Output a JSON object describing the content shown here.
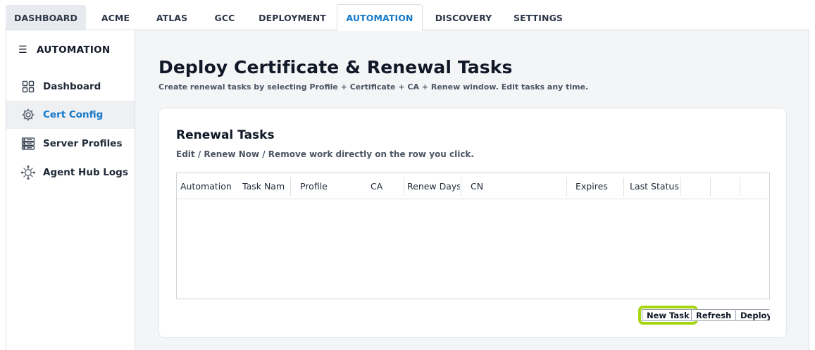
{
  "tabs": [
    {
      "label": "DASHBOARD"
    },
    {
      "label": "ACME"
    },
    {
      "label": "ATLAS"
    },
    {
      "label": "GCC"
    },
    {
      "label": "DEPLOYMENT"
    },
    {
      "label": "AUTOMATION"
    },
    {
      "label": "DISCOVERY"
    },
    {
      "label": "SETTINGS"
    }
  ],
  "sidebar": {
    "title": "AUTOMATION",
    "menu_icon": "hamburger-icon",
    "items": [
      {
        "label": "Dashboard",
        "icon": "grid-icon"
      },
      {
        "label": "Cert Config",
        "icon": "gear-icon"
      },
      {
        "label": "Server Profiles",
        "icon": "server-icon"
      },
      {
        "label": "Agent Hub Logs",
        "icon": "api-network-icon"
      }
    ]
  },
  "main": {
    "title": "Deploy Certificate & Renewal Tasks",
    "subtitle": "Create renewal tasks by selecting Profile + Certificate + CA + Renew window. Edit tasks any time.",
    "card": {
      "title": "Renewal Tasks",
      "subtitle": "Edit / Renew Now / Remove work directly on the row you click.",
      "columns": [
        "Automation",
        "Task Nam",
        "Profile",
        "CA",
        "Renew Days",
        "CN",
        "Expires",
        "Last Status",
        "",
        "",
        ""
      ],
      "rows": [],
      "buttons": {
        "new_task": "New Task",
        "refresh": "Refresh",
        "deploy": "Deploy"
      }
    }
  },
  "colors": {
    "accent": "#1479c9",
    "highlight": "#a6d610"
  }
}
